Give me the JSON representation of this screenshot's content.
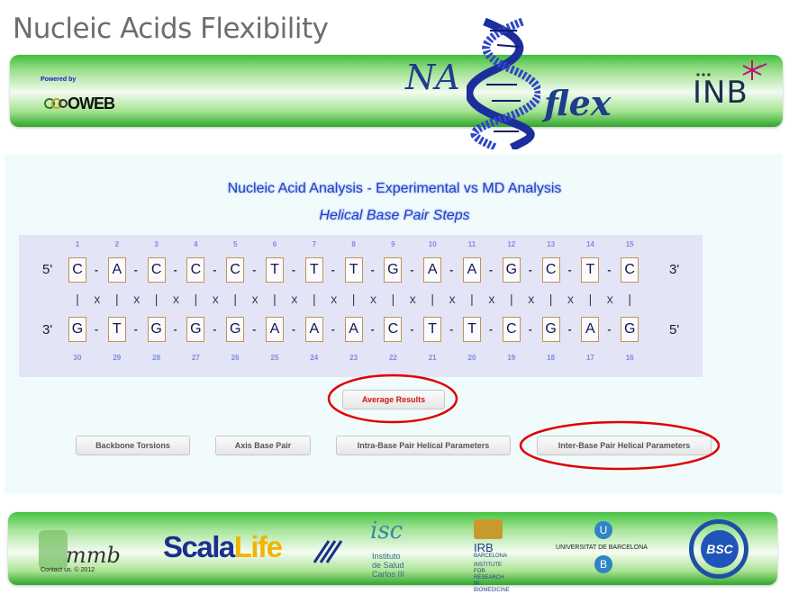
{
  "header": {
    "site_title": "Nucleic Acids Flexibility",
    "powered_by": "Powered by",
    "oweb_logo": "OWEB",
    "naflex_na": "NA",
    "naflex_flex": "flex",
    "inb_logo": "INB"
  },
  "analysis": {
    "title": "Nucleic Acid Analysis - Experimental vs MD Analysis",
    "subtitle": "Helical Base Pair Steps"
  },
  "sequence": {
    "top_numbers": [
      "1",
      "2",
      "3",
      "4",
      "5",
      "6",
      "7",
      "8",
      "9",
      "10",
      "11",
      "12",
      "13",
      "14",
      "15"
    ],
    "top_strand": [
      "C",
      "A",
      "C",
      "C",
      "C",
      "T",
      "T",
      "T",
      "G",
      "A",
      "A",
      "G",
      "C",
      "T",
      "C"
    ],
    "bottom_strand": [
      "G",
      "T",
      "G",
      "G",
      "G",
      "A",
      "A",
      "A",
      "C",
      "T",
      "T",
      "C",
      "G",
      "A",
      "G"
    ],
    "bottom_numbers": [
      "30",
      "29",
      "28",
      "27",
      "26",
      "25",
      "24",
      "23",
      "22",
      "21",
      "20",
      "19",
      "18",
      "17",
      "16"
    ],
    "top_start": "5'",
    "top_end": "3'",
    "bottom_start": "3'",
    "bottom_end": "5'",
    "pair_marks": [
      "|",
      "x",
      "|",
      "x",
      "|",
      "x",
      "|",
      "x",
      "|",
      "x",
      "|",
      "x",
      "|",
      "x",
      "|",
      "x",
      "|",
      "x",
      "|",
      "x",
      "|",
      "x",
      "|",
      "x",
      "|",
      "x",
      "|",
      "x",
      "|"
    ],
    "bond_symbol": "-"
  },
  "buttons": {
    "average_results": "Average Results",
    "backbone_torsions": "Backbone Torsions",
    "axis_base_pair": "Axis Base Pair",
    "intra_base_pair": "Intra-Base Pair Helical Parameters",
    "inter_base_pair": "Inter-Base Pair Helical Parameters"
  },
  "footer": {
    "mmb_logo": "mmb",
    "contact": "Contact us. © 2012",
    "scalalife_scala": "Scala",
    "scalalife_life": "Life",
    "isciii_mark": "isc",
    "isciii_line1": "Instituto",
    "isciii_line2": "de Salud",
    "isciii_line3": "Carlos III",
    "irb_text": "IRB",
    "irb_sub1": "BARCELONA",
    "irb_sub2": "INSTITUTE",
    "irb_sub3": "FOR RESEARCH",
    "irb_sub4": "IN BIOMEDICINE",
    "ub_top": "U",
    "ub_text": "UNIVERSITAT DE BARCELONA",
    "ub_bottom": "B",
    "bsc_logo": "BSC"
  },
  "colors": {
    "banner_green": "#3fbf3c",
    "title_blue": "#2740c8",
    "sequence_bg": "#e3e4f6",
    "annotation_red": "#e00000",
    "average_text": "#d21414"
  }
}
